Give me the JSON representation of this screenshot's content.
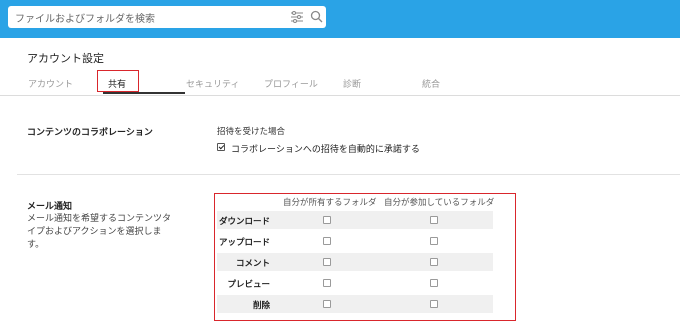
{
  "search": {
    "placeholder": "ファイルおよびフォルダを検索"
  },
  "page": {
    "title": "アカウント設定"
  },
  "tabs": [
    {
      "label": "アカウント",
      "active": false
    },
    {
      "label": "共有",
      "active": true
    },
    {
      "label": "セキュリティ",
      "active": false
    },
    {
      "label": "プロフィール",
      "active": false
    },
    {
      "label": "診断",
      "active": false
    },
    {
      "label": "統合",
      "active": false
    }
  ],
  "collaboration": {
    "title": "コンテンツのコラボレーション",
    "sub_label": "招待を受けた場合",
    "auto_accept": {
      "label": "コラボレーションへの招待を自動的に承諾する",
      "checked": true
    }
  },
  "email_notifications": {
    "title": "メール通知",
    "description": "メール通知を希望するコンテンツタイプおよびアクションを選択します。",
    "columns": [
      "自分が所有するフォルダ",
      "自分が参加しているフォルダ"
    ],
    "rows": [
      {
        "label": "ダウンロード",
        "owned": false,
        "participating": false
      },
      {
        "label": "アップロード",
        "owned": false,
        "participating": false
      },
      {
        "label": "コメント",
        "owned": false,
        "participating": false
      },
      {
        "label": "プレビュー",
        "owned": false,
        "participating": false
      },
      {
        "label": "削除",
        "owned": false,
        "participating": false
      }
    ]
  },
  "colors": {
    "topbar": "#2aa3e6",
    "highlight": "#d9262c"
  }
}
